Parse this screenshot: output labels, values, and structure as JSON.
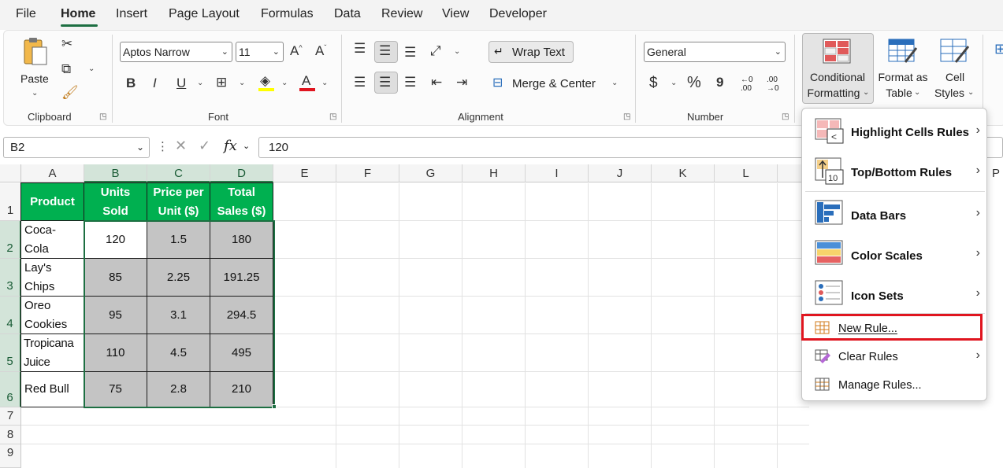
{
  "menu": {
    "tabs": [
      "File",
      "Home",
      "Insert",
      "Page Layout",
      "Formulas",
      "Data",
      "Review",
      "View",
      "Developer"
    ],
    "active": "Home"
  },
  "ribbon": {
    "clipboard": {
      "label": "Clipboard",
      "paste": "Paste"
    },
    "font": {
      "label": "Font",
      "name": "Aptos Narrow",
      "size": "11",
      "bold": "B",
      "italic": "I",
      "underline": "U",
      "grow": "A^",
      "shrink": "Aˇ",
      "font_color_glyph": "A"
    },
    "alignment": {
      "label": "Alignment",
      "wrap_text": "Wrap Text",
      "merge_center": "Merge & Center"
    },
    "number": {
      "label": "Number",
      "format": "General",
      "currency": "$",
      "percent": "%",
      "comma": "9"
    },
    "styles": {
      "conditional_formatting": [
        "Conditional",
        "Formatting"
      ],
      "format_as_table": [
        "Format as",
        "Table"
      ],
      "cell_styles": [
        "Cell",
        "Styles"
      ]
    }
  },
  "formula_bar": {
    "name_box": "B2",
    "fx": "fx",
    "value": "120"
  },
  "grid": {
    "columns": [
      "A",
      "B",
      "C",
      "D",
      "E",
      "F",
      "G",
      "H",
      "I",
      "J",
      "K",
      "L"
    ],
    "rows": [
      "1",
      "2",
      "3",
      "4",
      "5",
      "6",
      "7",
      "8",
      "9"
    ],
    "table_headers": [
      "Product",
      "Units Sold",
      "Price per Unit ($)",
      "Total Sales ($)"
    ],
    "table_rows": [
      {
        "product": "Coca-Cola",
        "units": "120",
        "price": "1.5",
        "total": "180"
      },
      {
        "product": "Lay's Chips",
        "units": "85",
        "price": "2.25",
        "total": "191.25"
      },
      {
        "product": "Oreo Cookies",
        "units": "95",
        "price": "3.1",
        "total": "294.5"
      },
      {
        "product": "Tropicana Juice",
        "units": "110",
        "price": "4.5",
        "total": "495"
      },
      {
        "product": "Red Bull",
        "units": "75",
        "price": "2.8",
        "total": "210"
      }
    ],
    "header_color": "#00b050",
    "selection_fill": "#c4c4c4"
  },
  "cf_menu": {
    "items": [
      {
        "label": "Highlight Cells Rules",
        "icon": "highlight-cells-icon",
        "submenu": true
      },
      {
        "label": "Top/Bottom Rules",
        "icon": "top-bottom-icon",
        "submenu": true
      },
      {
        "label": "Data Bars",
        "icon": "data-bars-icon",
        "submenu": true
      },
      {
        "label": "Color Scales",
        "icon": "color-scales-icon",
        "submenu": true
      },
      {
        "label": "Icon Sets",
        "icon": "icon-sets-icon",
        "submenu": true
      },
      {
        "label": "New Rule...",
        "icon": "new-rule-icon",
        "submenu": false
      },
      {
        "label": "Clear Rules",
        "icon": "clear-rules-icon",
        "submenu": true
      },
      {
        "label": "Manage Rules...",
        "icon": "manage-rules-icon",
        "submenu": false
      }
    ],
    "highlighted": "New Rule...",
    "highlight_color": "#e0151f"
  }
}
